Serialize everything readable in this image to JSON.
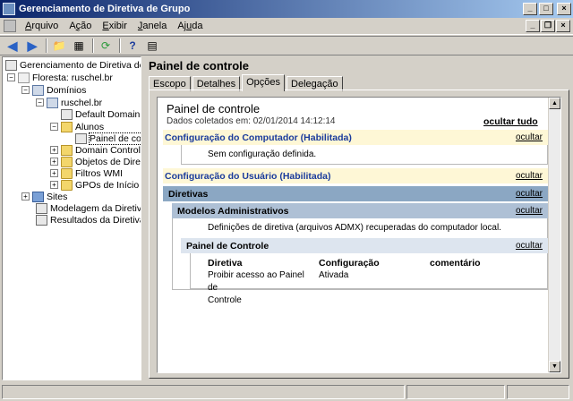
{
  "window": {
    "title": "Gerenciamento de Diretiva de Grupo"
  },
  "menu": [
    {
      "label": "Arquivo",
      "key": "A"
    },
    {
      "label": "Ação",
      "key": "ç"
    },
    {
      "label": "Exibir",
      "key": "E"
    },
    {
      "label": "Janela",
      "key": "J"
    },
    {
      "label": "Ajuda",
      "key": "u"
    }
  ],
  "tree": {
    "items": [
      {
        "label": "Gerenciamento de Diretiva de Grupo"
      },
      {
        "label": "Floresta: ruschel.br"
      },
      {
        "label": "Domínios"
      },
      {
        "label": "ruschel.br"
      },
      {
        "label": "Default Domain Po"
      },
      {
        "label": "Alunos"
      },
      {
        "label": "Painel de contr"
      },
      {
        "label": "Domain Controller"
      },
      {
        "label": "Objetos de Diretiv"
      },
      {
        "label": "Filtros WMI"
      },
      {
        "label": "GPOs de Início"
      },
      {
        "label": "Sites"
      },
      {
        "label": "Modelagem da Diretiva de"
      },
      {
        "label": "Resultados da Diretiva de"
      }
    ]
  },
  "pane": {
    "title": "Painel de controle",
    "tabs": [
      "Escopo",
      "Detalhes",
      "Opções",
      "Delegação"
    ]
  },
  "report": {
    "title": "Painel de controle",
    "collected": "Dados coletados em: 02/01/2014 14:12:14",
    "hide_all": "ocultar tudo",
    "computer_section": "Configuração do Computador (Habilitada)",
    "computer_link": "ocultar",
    "no_config": "Sem configuração definida.",
    "user_section": "Configuração do Usuário (Habilitada)",
    "user_link": "ocultar",
    "policies": "Diretivas",
    "policies_link": "ocultar",
    "admin_templates": "Modelos Administrativos",
    "admin_link": "ocultar",
    "admx_note": "Definições de diretiva (arquivos ADMX) recuperadas do computador local.",
    "control_panel": "Painel de Controle",
    "control_link": "ocultar",
    "table_headers": [
      "Diretiva",
      "Configuração",
      "comentário"
    ],
    "table_rows": [
      {
        "policy_line1": "Proibir acesso ao Painel de",
        "policy_line2": "Controle",
        "setting": "Ativada"
      }
    ]
  }
}
